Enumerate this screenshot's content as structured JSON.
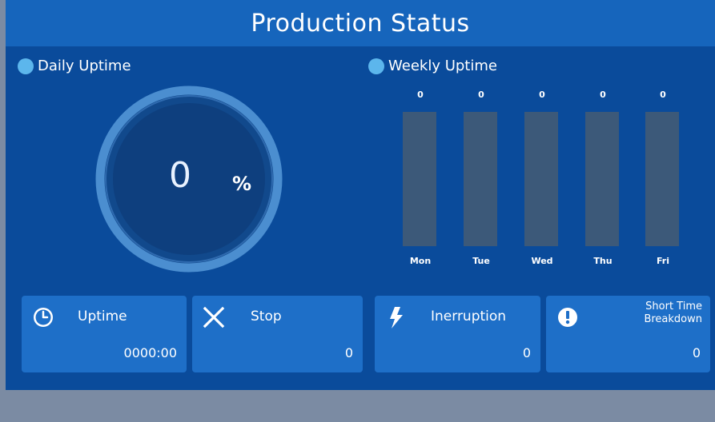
{
  "header": {
    "title": "Production Status"
  },
  "daily": {
    "title": "Daily Uptime",
    "value": "0",
    "unit": "%",
    "percent": 0
  },
  "weekly": {
    "title": "Weekly Uptime",
    "days": [
      {
        "label": "Mon",
        "value": "0"
      },
      {
        "label": "Tue",
        "value": "0"
      },
      {
        "label": "Wed",
        "value": "0"
      },
      {
        "label": "Thu",
        "value": "0"
      },
      {
        "label": "Fri",
        "value": "0"
      }
    ]
  },
  "cards": {
    "uptime": {
      "label": "Uptime",
      "value": "0000:00",
      "icon": "clock-icon"
    },
    "stop": {
      "label": "Stop",
      "value": "0",
      "icon": "x-icon"
    },
    "interruption": {
      "label": "Inerruption",
      "value": "0",
      "icon": "lightning-icon"
    },
    "breakdown": {
      "label_line1": "Short Time",
      "label_line2": "Breakdown",
      "value": "0",
      "icon": "exclamation-icon"
    }
  },
  "colors": {
    "panel": "#0a4b9b",
    "header": "#1665bc",
    "accent": "#5cb6ec",
    "card": "#1e6fc8",
    "bar_track": "#3c5979",
    "footer": "#7b8ba3"
  }
}
